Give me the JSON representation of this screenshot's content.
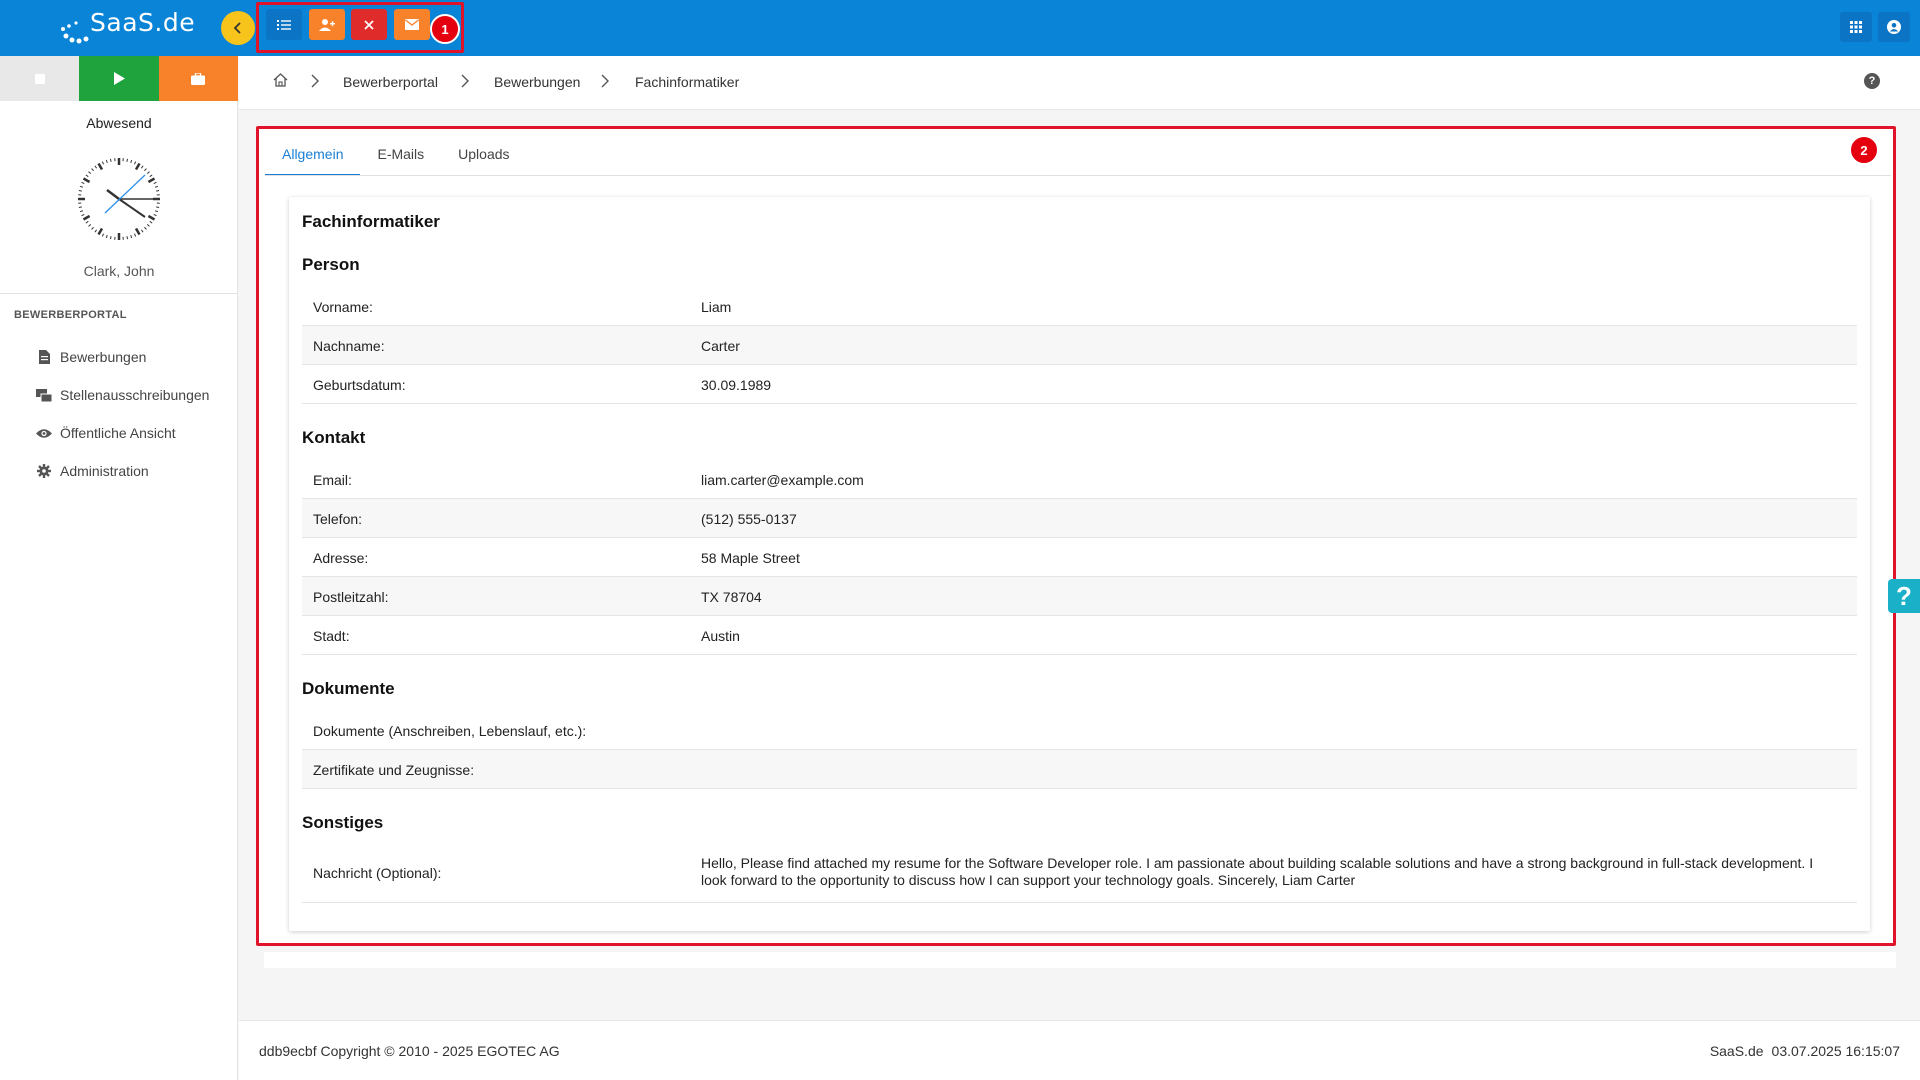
{
  "app": {
    "logo_text": "SaaS.de"
  },
  "toolbar": {
    "badge": "1"
  },
  "sidebar": {
    "status": "Abwesend",
    "user": "Clark, John",
    "section": "BEWERBERPORTAL",
    "items": [
      {
        "label": "Bewerbungen",
        "icon": "document-icon"
      },
      {
        "label": "Stellenausschreibungen",
        "icon": "postings-icon"
      },
      {
        "label": "Öffentliche Ansicht",
        "icon": "eye-icon"
      },
      {
        "label": "Administration",
        "icon": "gear-icon"
      }
    ]
  },
  "breadcrumb": [
    "Bewerberportal",
    "Bewerbungen",
    "Fachinformatiker"
  ],
  "main": {
    "badge": "2",
    "tabs": [
      "Allgemein",
      "E-Mails",
      "Uploads"
    ],
    "title": "Fachinformatiker",
    "person": {
      "heading": "Person",
      "rows": [
        {
          "label": "Vorname:",
          "value": "Liam"
        },
        {
          "label": "Nachname:",
          "value": "Carter"
        },
        {
          "label": "Geburtsdatum:",
          "value": "30.09.1989"
        }
      ]
    },
    "kontakt": {
      "heading": "Kontakt",
      "rows": [
        {
          "label": "Email:",
          "value": "liam.carter@example.com"
        },
        {
          "label": "Telefon:",
          "value": "(512) 555-0137"
        },
        {
          "label": "Adresse:",
          "value": "58 Maple Street"
        },
        {
          "label": "Postleitzahl:",
          "value": "TX 78704"
        },
        {
          "label": "Stadt:",
          "value": "Austin"
        }
      ]
    },
    "dokumente": {
      "heading": "Dokumente",
      "rows": [
        {
          "label": "Dokumente (Anschreiben, Lebenslauf, etc.):",
          "value": ""
        },
        {
          "label": "Zertifikate und Zeugnisse:",
          "value": ""
        }
      ]
    },
    "sonstiges": {
      "heading": "Sonstiges",
      "rows": [
        {
          "label": "Nachricht (Optional):",
          "value": "Hello, Please find attached my resume for the Software Developer role. I am passionate about building scalable solutions and have a strong background in full-stack development. I look forward to the opportunity to discuss how I can support your technology goals. Sincerely, Liam Carter"
        }
      ]
    }
  },
  "footer": {
    "copyright": "ddb9ecbf Copyright © 2010 - 2025 EGOTEC AG",
    "brand": "SaaS.de",
    "datetime": "03.07.2025 16:15:07"
  },
  "colors": {
    "topbar": "#0984d6",
    "accent": "#1a7fd4",
    "highlight": "#e0132a"
  }
}
